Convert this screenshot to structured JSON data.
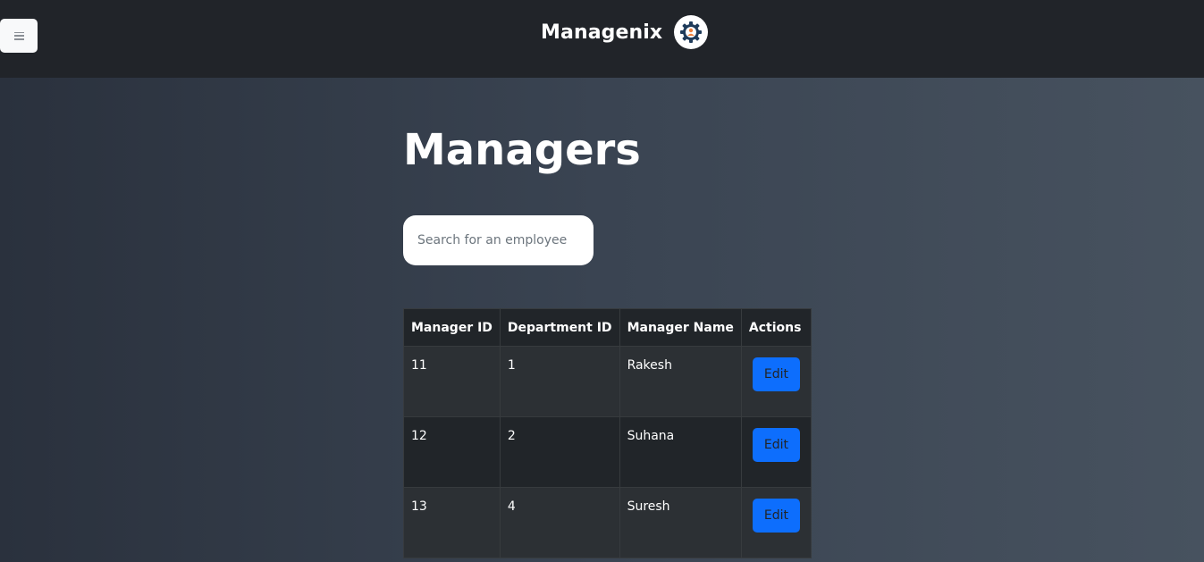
{
  "navbar": {
    "menu_icon": "hamburger-icon",
    "brand": "Managenix",
    "logo_icon": "gear-user-icon",
    "colors": {
      "background": "#212429",
      "logo_gear": "#1f3b5a",
      "logo_person": "#f0803c"
    }
  },
  "main": {
    "title": "Managers",
    "search": {
      "placeholder": "Search for an employee",
      "value": ""
    },
    "table": {
      "headers": [
        "Manager ID",
        "Department ID",
        "Manager Name",
        "Actions"
      ],
      "rows": [
        {
          "manager_id": "11",
          "department_id": "1",
          "manager_name": "Rakesh",
          "action": "Edit"
        },
        {
          "manager_id": "12",
          "department_id": "2",
          "manager_name": "Suhana",
          "action": "Edit"
        },
        {
          "manager_id": "13",
          "department_id": "4",
          "manager_name": "Suresh",
          "action": "Edit"
        }
      ]
    }
  },
  "colors": {
    "edit_button": "#0d6efd",
    "row_odd": "#2c3034",
    "row_even": "#212529"
  }
}
